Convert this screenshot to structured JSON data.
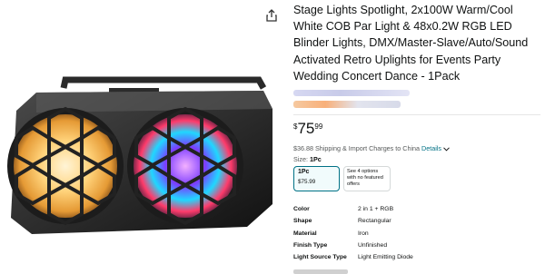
{
  "product": {
    "title": "Stage Lights Spotlight, 2x100W Warm/Cool White COB Par Light & 48x0.2W RGB LED Blinder Lights, DMX/Master-Slave/Auto/Sound Activated Retro Uplights for Events Party Wedding Concert Dance - 1Pack",
    "price_symbol": "$",
    "price_whole": "75",
    "price_fraction": "99",
    "shipping_text": "$36.88 Shipping & Import Charges to China",
    "shipping_link": "Details",
    "size_label": "Size:",
    "size_value": "1Pc",
    "options": [
      {
        "name": "1Pc",
        "price": "$75.99"
      },
      {
        "text": "See 4 options with no featured offers"
      }
    ],
    "specs": [
      {
        "key": "Color",
        "value": "2 in 1 + RGB"
      },
      {
        "key": "Shape",
        "value": "Rectangular"
      },
      {
        "key": "Material",
        "value": "Iron"
      },
      {
        "key": "Finish Type",
        "value": "Unfinished"
      },
      {
        "key": "Light Source Type",
        "value": "Light Emitting Diode"
      }
    ]
  },
  "icons": {
    "share": "share-icon",
    "chevron": "chevron-down-icon"
  },
  "colors": {
    "link": "#007185",
    "text": "#0f1111",
    "muted": "#565959"
  }
}
